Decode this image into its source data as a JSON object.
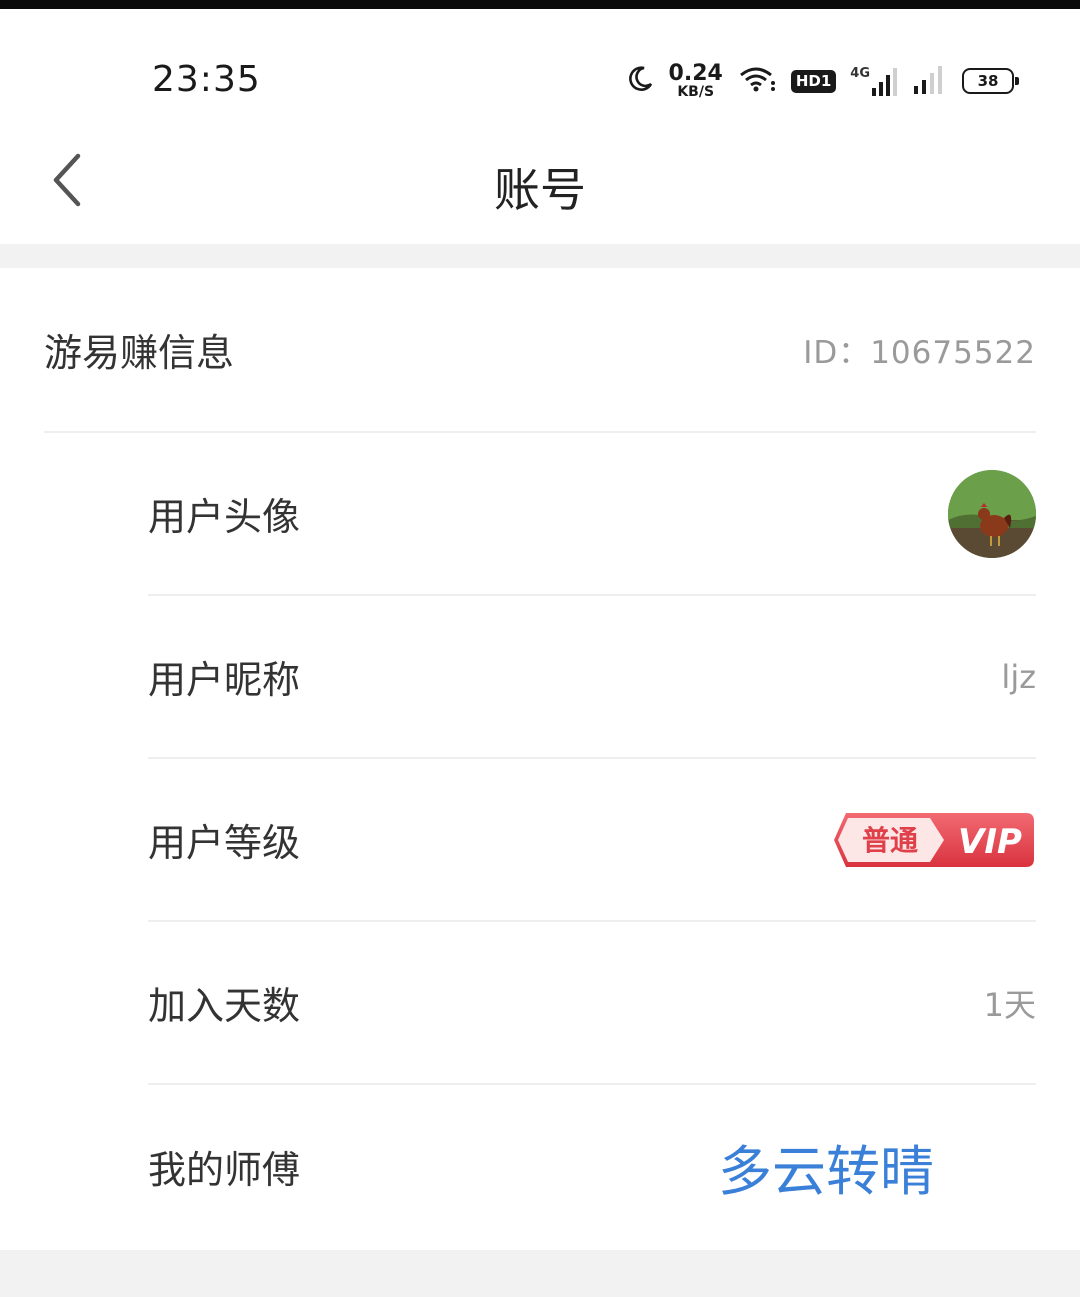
{
  "status_bar": {
    "time": "23:35",
    "net_speed_value": "0.24",
    "net_speed_unit": "KB/S",
    "hd_label": "HD1",
    "network_type": "4G",
    "battery": "38"
  },
  "nav": {
    "title": "账号"
  },
  "section": {
    "title": "游易赚信息",
    "id_text": "ID：10675522"
  },
  "rows": [
    {
      "label": "用户头像"
    },
    {
      "label": "用户昵称",
      "value": "ljz"
    },
    {
      "label": "用户等级",
      "vip_level": "普通",
      "vip_tag": "VIP"
    },
    {
      "label": "加入天数",
      "value": "1天"
    },
    {
      "label": "我的师傅",
      "value": "多云转晴"
    }
  ],
  "colors": {
    "accent_red": "#e8434f",
    "weather_blue": "#3a7fd8"
  }
}
